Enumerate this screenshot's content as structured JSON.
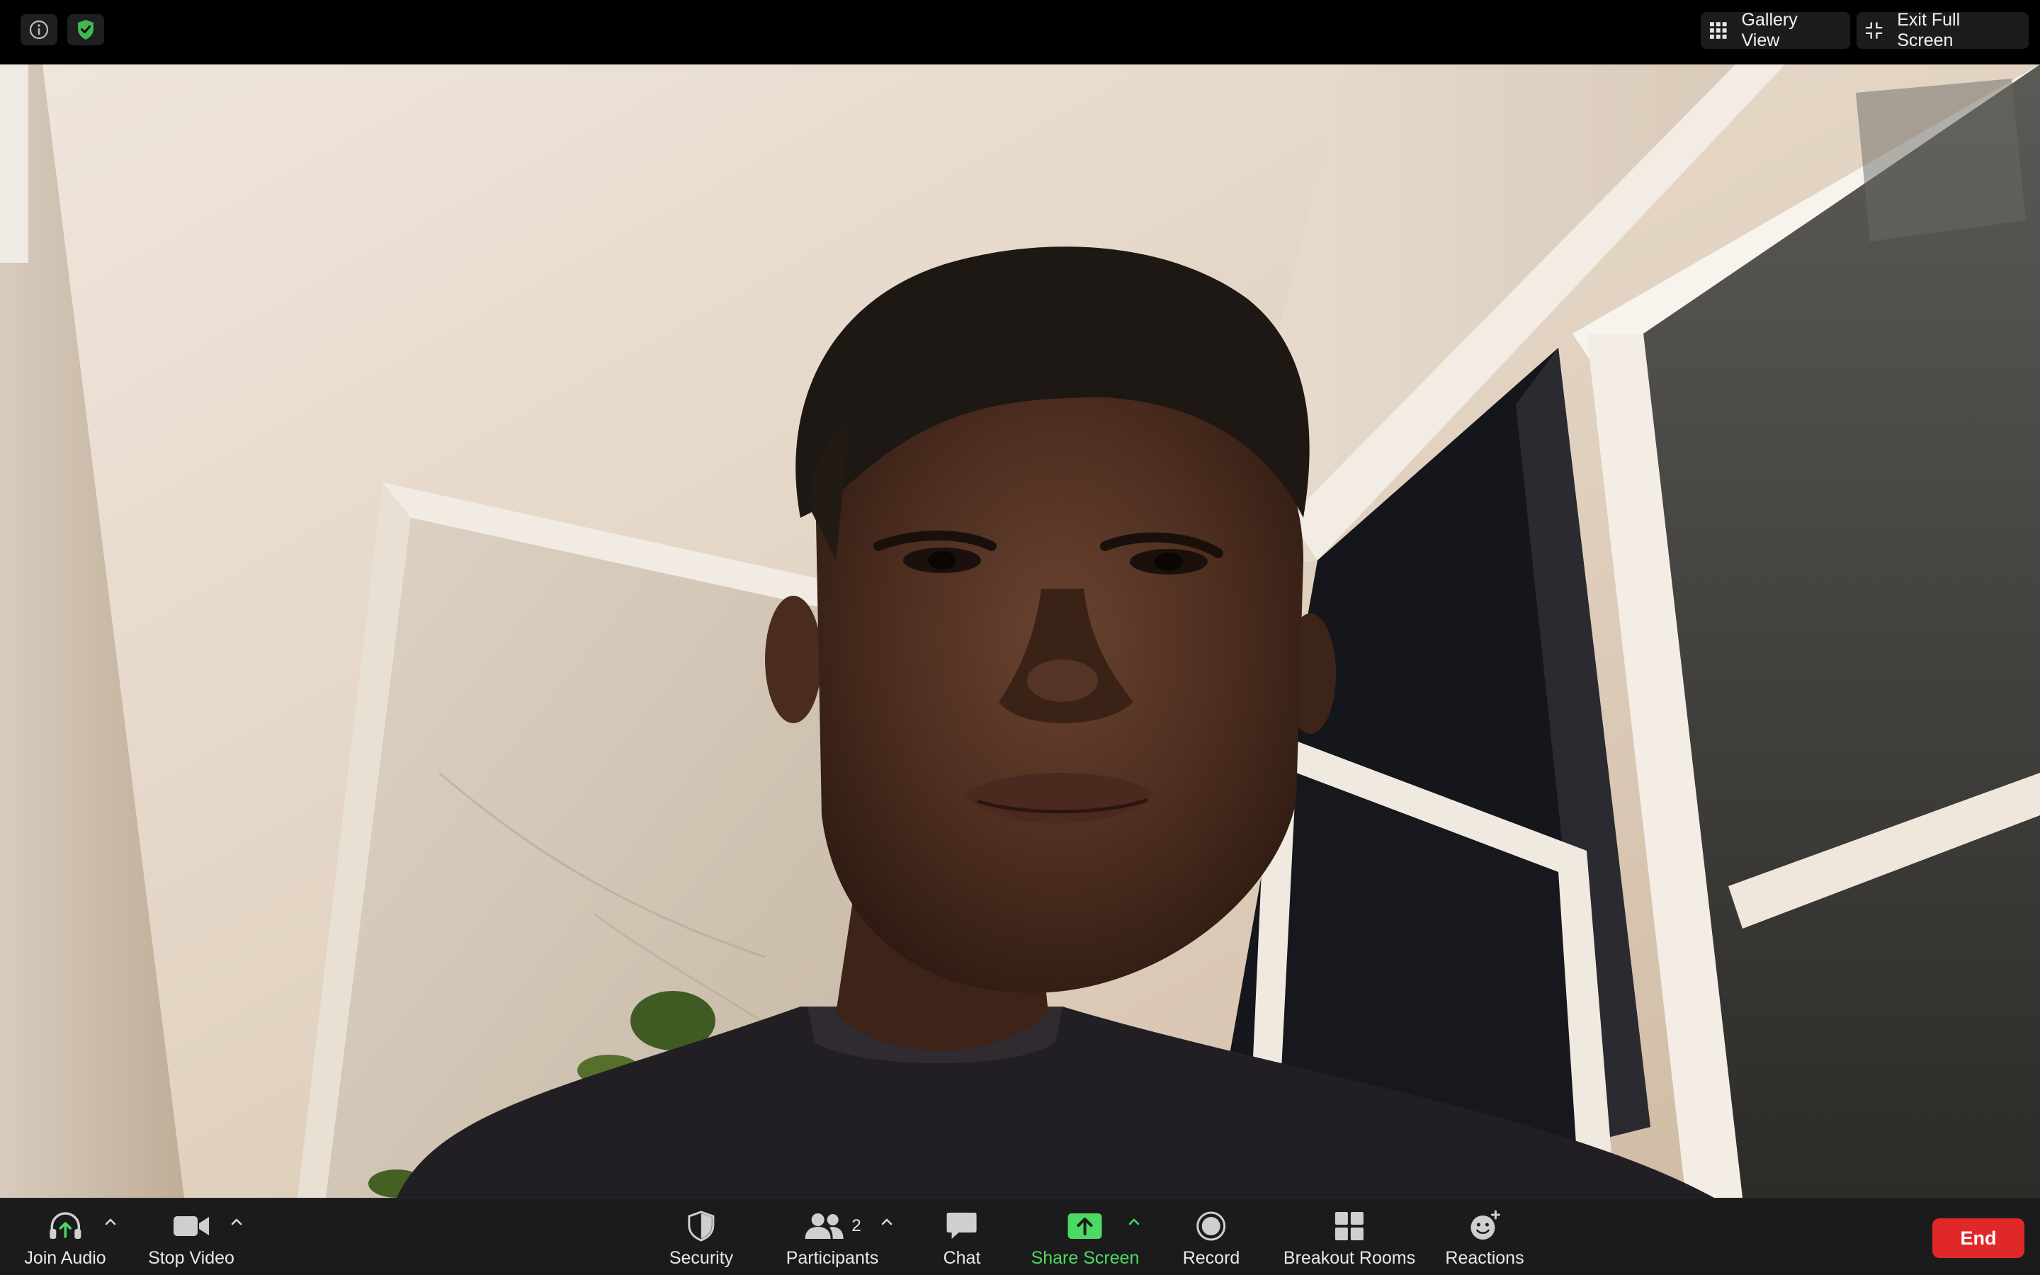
{
  "top_bar": {
    "info_icon": "info-icon",
    "shield_icon": "encryption-shield-icon",
    "gallery_view_label": "Gallery View",
    "exit_full_screen_label": "Exit Full Screen"
  },
  "video": {
    "description_icon": "participant-video-feed"
  },
  "toolbar": {
    "join_audio_label": "Join Audio",
    "stop_video_label": "Stop Video",
    "security_label": "Security",
    "participants_label": "Participants",
    "participants_count": "2",
    "chat_label": "Chat",
    "share_screen_label": "Share Screen",
    "record_label": "Record",
    "breakout_rooms_label": "Breakout Rooms",
    "reactions_label": "Reactions",
    "end_label": "End"
  },
  "colors": {
    "share_screen_accent": "#4cd964",
    "end_button": "#e02828",
    "toolbar_bg": "#1b1b1b",
    "shield_green": "#3fb950"
  }
}
